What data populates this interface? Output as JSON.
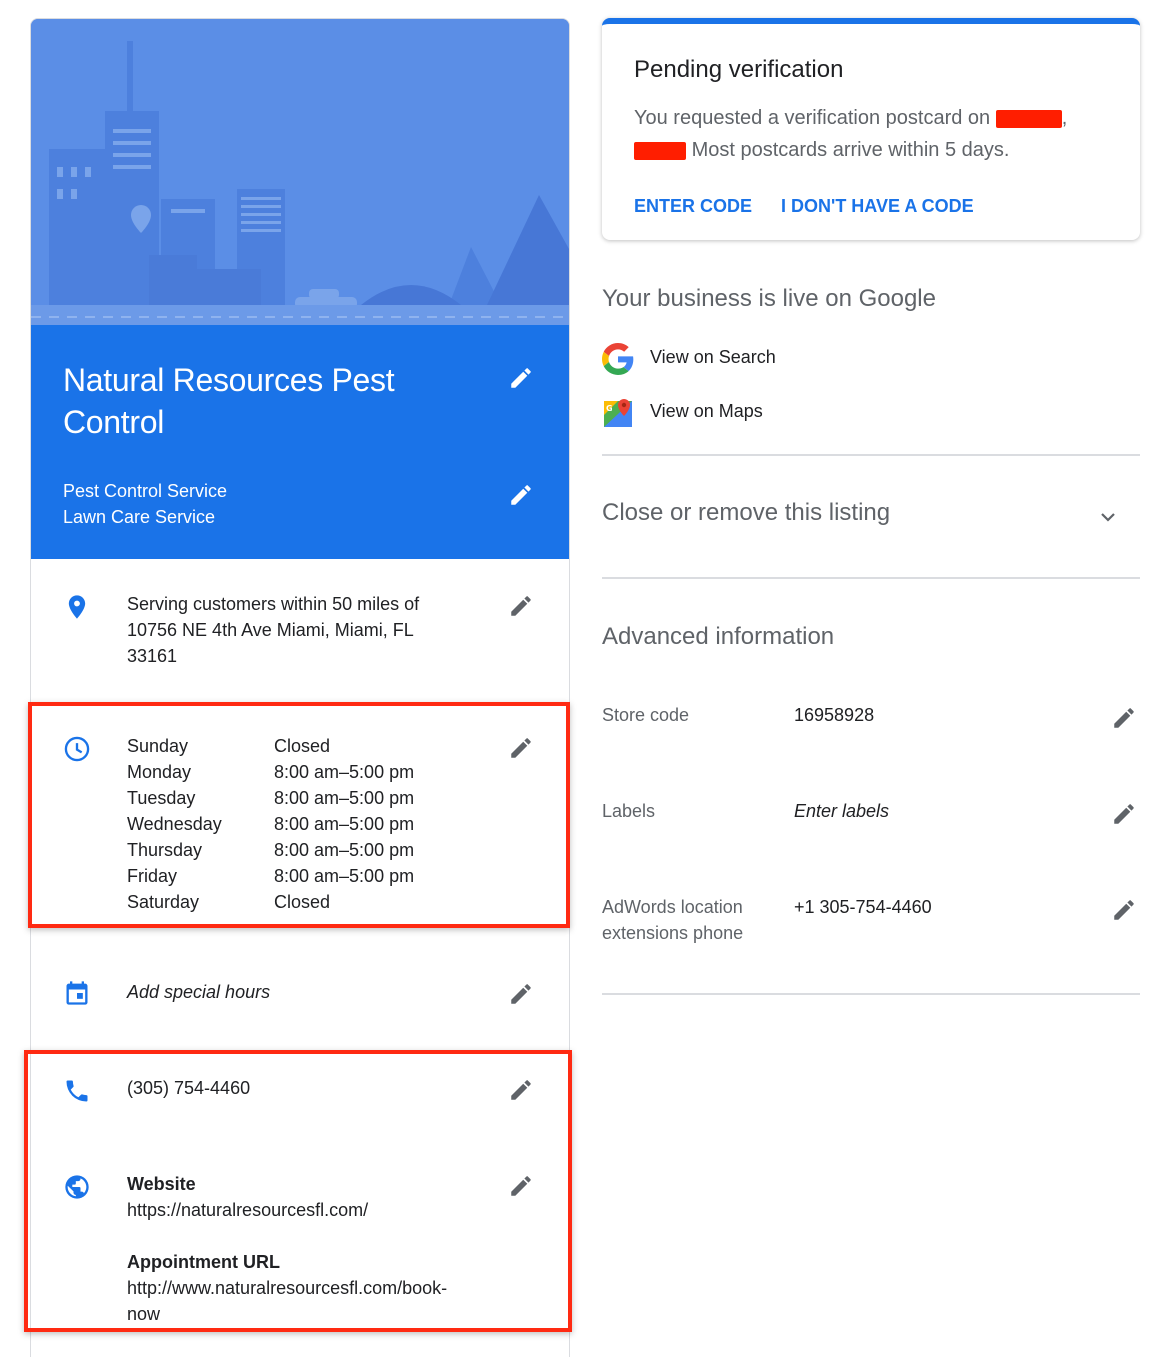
{
  "business": {
    "name": "Natural Resources Pest Control",
    "categories": [
      "Pest Control Service",
      "Lawn Care Service"
    ]
  },
  "address": {
    "lines": [
      "Serving customers within 50 miles of",
      "10756 NE 4th Ave Miami, Miami, FL",
      "33161"
    ]
  },
  "hours": [
    {
      "day": "Sunday",
      "time": "Closed"
    },
    {
      "day": "Monday",
      "time": "8:00 am–5:00 pm"
    },
    {
      "day": "Tuesday",
      "time": "8:00 am–5:00 pm"
    },
    {
      "day": "Wednesday",
      "time": "8:00 am–5:00 pm"
    },
    {
      "day": "Thursday",
      "time": "8:00 am–5:00 pm"
    },
    {
      "day": "Friday",
      "time": "8:00 am–5:00 pm"
    },
    {
      "day": "Saturday",
      "time": "Closed"
    }
  ],
  "special_hours": "Add special hours",
  "phone": "(305) 754-4460",
  "website": {
    "label": "Website",
    "url": "https://naturalresourcesfl.com/",
    "appointment_label": "Appointment URL",
    "appointment_url_lines": [
      "http://www.naturalresourcesfl.com/book-",
      "now"
    ]
  },
  "pending": {
    "title": "Pending verification",
    "line1": "You requested a verification postcard on",
    "line2_suffix": "Most postcards arrive within 5 days.",
    "enter_code": "ENTER CODE",
    "no_code": "I DON'T HAVE A CODE"
  },
  "live": {
    "title": "Your business is live on Google",
    "view_search": "View on Search",
    "view_maps": "View on Maps"
  },
  "close_listing": "Close or remove this listing",
  "advanced": {
    "title": "Advanced information",
    "store_code_label": "Store code",
    "store_code_value": "16958928",
    "labels_label": "Labels",
    "labels_placeholder": "Enter labels",
    "adwords_label_lines": [
      "AdWords location",
      "extensions phone"
    ],
    "adwords_value": "+1 305-754-4460"
  },
  "colors": {
    "primary_blue": "#1a73e8",
    "hero_blue": "#5b8ee6",
    "annotation_red": "#ff2a12"
  },
  "icons": [
    "location-pin-icon",
    "clock-icon",
    "calendar-icon",
    "phone-icon",
    "globe-icon",
    "pencil-icon",
    "google-g-icon",
    "google-maps-icon",
    "chevron-down-icon"
  ]
}
